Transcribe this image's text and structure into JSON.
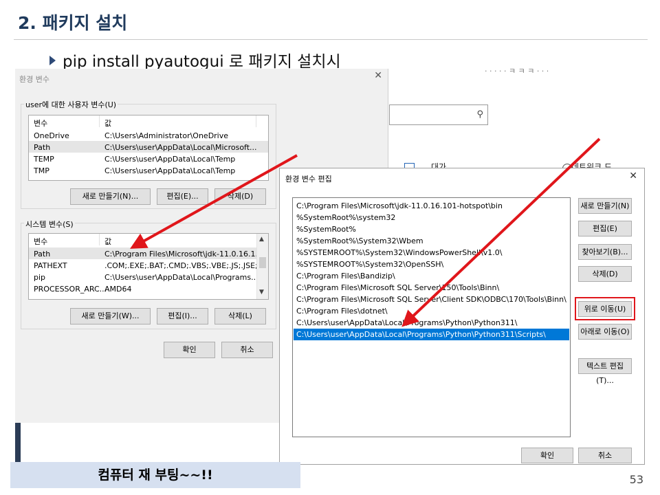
{
  "slide": {
    "title": "2. 패키지 설치",
    "bullet": "pip install pyautogui 로 패키지 설치시",
    "banner": "컴퓨터 재 부팅~~!!",
    "page_number": "53"
  },
  "background_window": {
    "header_fragment": "· · · · · ㅋ ㅋ ㅋ · · ·",
    "fragment1": "대가",
    "fragment2": "네트워크 드"
  },
  "env_dialog": {
    "title": "환경 변수",
    "user_group_label": "user에 대한 사용자 변수(U)",
    "columns": [
      "변수",
      "값"
    ],
    "user_vars": [
      {
        "name": "OneDrive",
        "value": "C:\\Users\\Administrator\\OneDrive"
      },
      {
        "name": "Path",
        "value": "C:\\Users\\user\\AppData\\Local\\Microsoft..."
      },
      {
        "name": "TEMP",
        "value": "C:\\Users\\user\\AppData\\Local\\Temp"
      },
      {
        "name": "TMP",
        "value": "C:\\Users\\user\\AppData\\Local\\Temp"
      }
    ],
    "user_buttons": {
      "new": "새로 만들기(N)...",
      "edit": "편집(E)...",
      "delete": "삭제(D)"
    },
    "system_group_label": "시스템 변수(S)",
    "system_vars": [
      {
        "name": "Path",
        "value": "C:\\Program Files\\Microsoft\\jdk-11.0.16.1..."
      },
      {
        "name": "PATHEXT",
        "value": ".COM;.EXE;.BAT;.CMD;.VBS;.VBE;.JS;.JSE;.W..."
      },
      {
        "name": "pip",
        "value": "C:\\Users\\user\\AppData\\Local\\Programs..."
      },
      {
        "name": "PROCESSOR_ARC...",
        "value": "AMD64"
      }
    ],
    "system_buttons": {
      "new": "새로 만들기(W)...",
      "edit": "편집(I)...",
      "delete": "삭제(L)"
    },
    "ok": "확인",
    "cancel": "취소"
  },
  "edit_dialog": {
    "title": "환경 변수 편집",
    "paths": [
      "C:\\Program Files\\Microsoft\\jdk-11.0.16.101-hotspot\\bin",
      "%SystemRoot%\\system32",
      "%SystemRoot%",
      "%SystemRoot%\\System32\\Wbem",
      "%SYSTEMROOT%\\System32\\WindowsPowerShell\\v1.0\\",
      "%SYSTEMROOT%\\System32\\OpenSSH\\",
      "C:\\Program Files\\Bandizip\\",
      "C:\\Program Files\\Microsoft SQL Server\\150\\Tools\\Binn\\",
      "C:\\Program Files\\Microsoft SQL Server\\Client SDK\\ODBC\\170\\Tools\\Binn\\",
      "C:\\Program Files\\dotnet\\",
      "C:\\Users\\user\\AppData\\Local\\Programs\\Python\\Python311\\",
      "C:\\Users\\user\\AppData\\Local\\Programs\\Python\\Python311\\Scripts\\"
    ],
    "selected_index": 11,
    "buttons": {
      "new": "새로 만들기(N)",
      "edit": "편집(E)",
      "browse": "찾아보기(B)...",
      "delete": "삭제(D)",
      "move_up": "위로 이동(U)",
      "move_down": "아래로 이동(O)",
      "edit_text": "텍스트 편집(T)..."
    },
    "ok": "확인",
    "cancel": "취소"
  },
  "colors": {
    "title": "#1f3a5c",
    "annotation_red": "#e0161b",
    "selection_blue": "#0078d7",
    "banner_bg": "#d6e0f0"
  }
}
